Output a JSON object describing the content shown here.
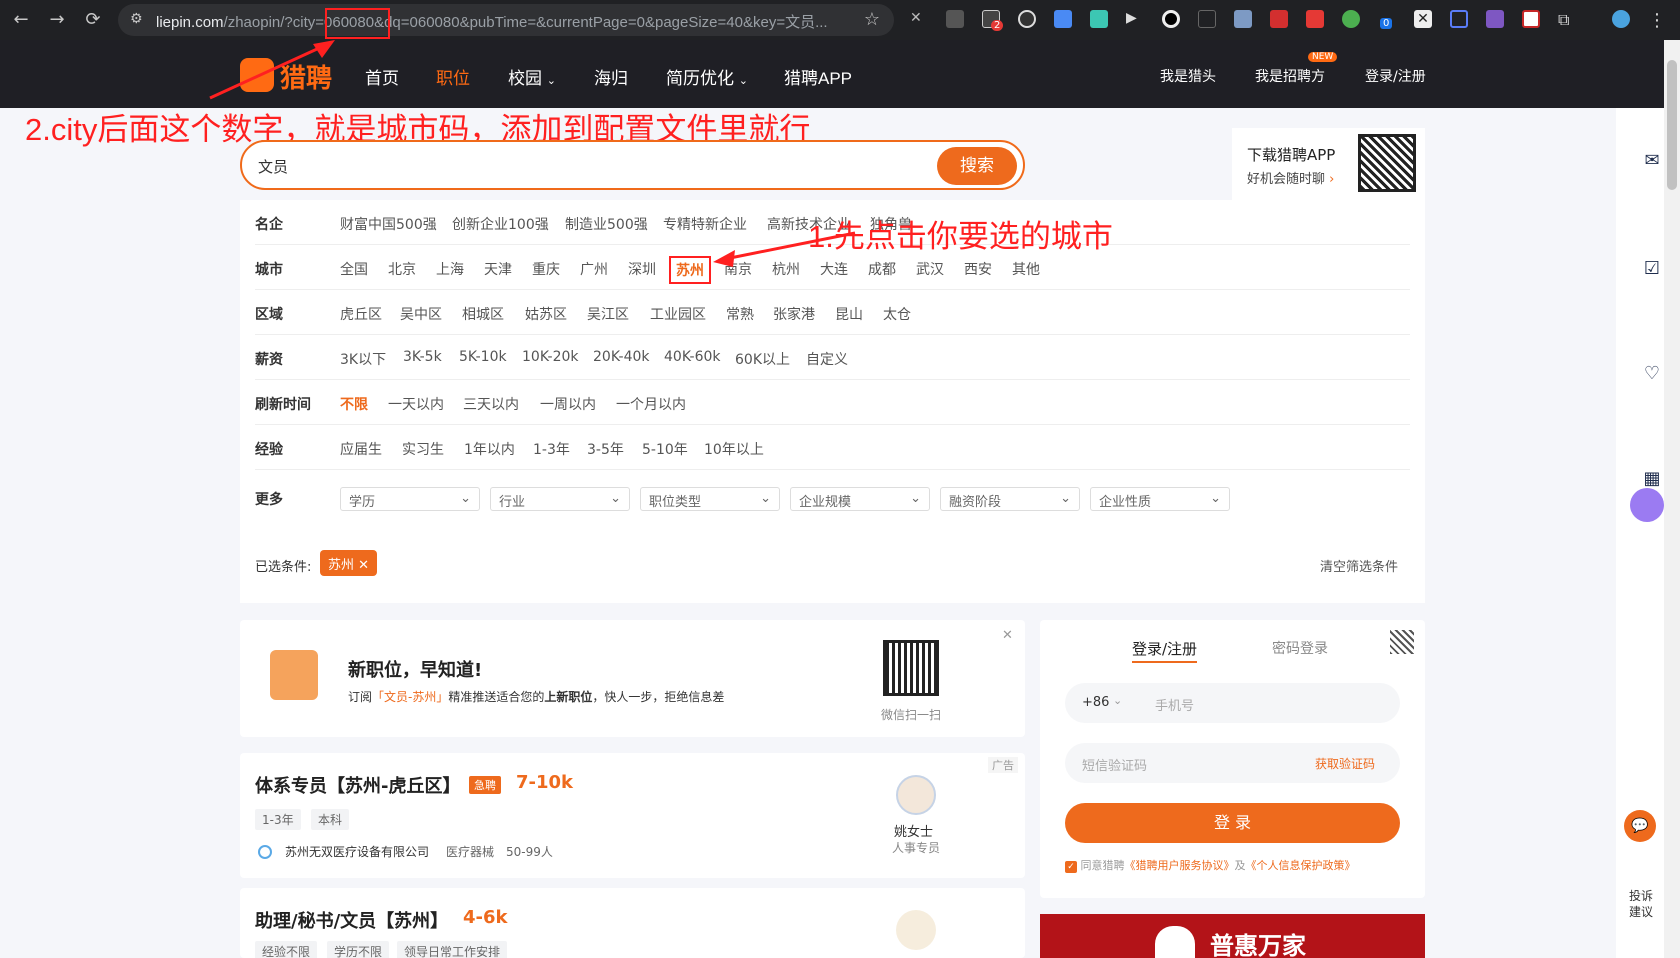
{
  "browser": {
    "url_host": "liepin.com",
    "url_path": "/zhaopin/?city=",
    "url_city": "060080",
    "url_rest": "&dq=060080&pubTime=&currentPage=0&pageSize=40&key=文员...",
    "ext_badge_1": "2",
    "ext_badge_2": "0"
  },
  "header": {
    "logo_text": "猎聘",
    "nav": [
      "首页",
      "职位",
      "校园",
      "海归",
      "简历优化",
      "猎聘APP"
    ],
    "right": [
      "我是猎头",
      "我是招聘方",
      "登录/注册"
    ],
    "new_badge": "NEW"
  },
  "annotations": {
    "step2": "2.city后面这个数字，就是城市码，添加到配置文件里就行",
    "step1": "1.先点击你要选的城市"
  },
  "search": {
    "value": "文员",
    "button": "搜索"
  },
  "app_download": {
    "title": "下载猎聘APP",
    "subtitle": "好机会随时聊"
  },
  "filters": {
    "rows": [
      {
        "label": "名企",
        "options": [
          "财富中国500强",
          "创新企业100强",
          "制造业500强",
          "专精特新企业",
          "高新技术企业",
          "独角兽"
        ]
      },
      {
        "label": "城市",
        "options": [
          "全国",
          "北京",
          "上海",
          "天津",
          "重庆",
          "广州",
          "深圳",
          "苏州",
          "南京",
          "杭州",
          "大连",
          "成都",
          "武汉",
          "西安",
          "其他"
        ]
      },
      {
        "label": "区域",
        "options": [
          "虎丘区",
          "吴中区",
          "相城区",
          "姑苏区",
          "吴江区",
          "工业园区",
          "常熟",
          "张家港",
          "昆山",
          "太仓"
        ]
      },
      {
        "label": "薪资",
        "options": [
          "3K以下",
          "3K-5k",
          "5K-10k",
          "10K-20k",
          "20K-40k",
          "40K-60k",
          "60K以上",
          "自定义"
        ]
      },
      {
        "label": "刷新时间",
        "options": [
          "不限",
          "一天以内",
          "三天以内",
          "一周以内",
          "一个月以内"
        ]
      },
      {
        "label": "经验",
        "options": [
          "应届生",
          "实习生",
          "1年以内",
          "1-3年",
          "3-5年",
          "5-10年",
          "10年以上"
        ]
      }
    ],
    "more_label": "更多",
    "more_selects": [
      "学历",
      "行业",
      "职位类型",
      "企业规模",
      "融资阶段",
      "企业性质"
    ],
    "selected_label": "已选条件:",
    "selected_chip": "苏州",
    "clear": "清空筛选条件"
  },
  "subscribe": {
    "title": "新职位，早知道!",
    "desc_pre": "订阅",
    "desc_key": "「文员-苏州」",
    "desc_mid": "精准推送适合您的",
    "desc_bold": "上新职位",
    "desc_post": "，快人一步，拒绝信息差",
    "qr_caption": "微信扫一扫"
  },
  "jobs": [
    {
      "title": "体系专员【苏州-虎丘区】",
      "badge": "急聘",
      "salary": "7-10k",
      "tags": [
        "1-3年",
        "本科"
      ],
      "company": "苏州无双医疗设备有限公司",
      "industry": "医疗器械",
      "size": "50-99人",
      "contact": "姚女士",
      "role": "人事专员",
      "ad": "广告"
    },
    {
      "title": "助理/秘书/文员【苏州】",
      "salary": "4-6k",
      "tags": [
        "经验不限",
        "学历不限",
        "领导日常工作安排"
      ]
    }
  ],
  "login": {
    "tab_active": "登录/注册",
    "tab_other": "密码登录",
    "country_code": "+86",
    "phone_placeholder": "手机号",
    "code_placeholder": "短信验证码",
    "get_code": "获取验证码",
    "button": "登 录",
    "agree_pre": "同意猎聘",
    "agree_link1": "《猎聘用户服务协议》",
    "agree_and": "及",
    "agree_link2": "《个人信息保护政策》"
  },
  "banner": {
    "text": "普惠万家"
  },
  "rail": {
    "feedback": "投诉建议"
  },
  "colors": {
    "accent": "#ee6a1d",
    "annotation": "#ff2020",
    "header_bg": "#1f1f25"
  }
}
